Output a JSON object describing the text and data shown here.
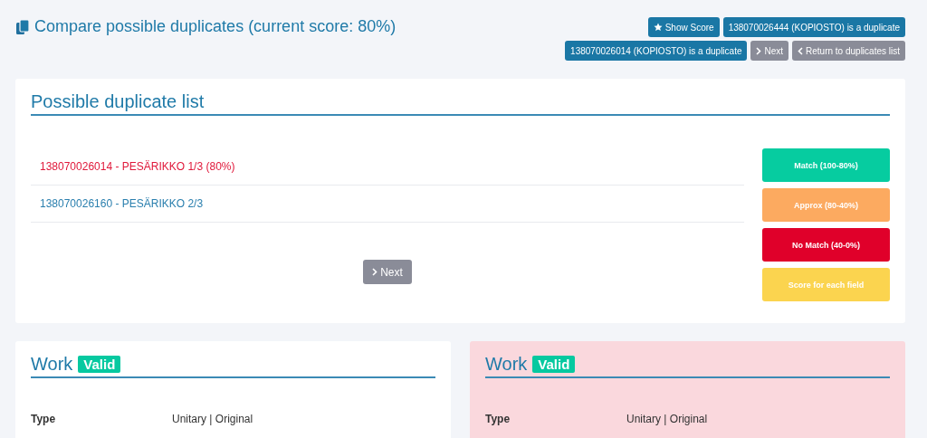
{
  "header": {
    "title": "Compare possible duplicates (current score: 80%)"
  },
  "actions": [
    {
      "label": "Show Score",
      "kind": "score"
    },
    {
      "label": "138070026444 (KOPIOSTO) is a duplicate",
      "kind": "duplicate"
    },
    {
      "label": "138070026014 (KOPIOSTO) is a duplicate",
      "kind": "duplicate"
    },
    {
      "label": "Next",
      "kind": "next"
    },
    {
      "label": "Return to duplicates list",
      "kind": "back"
    }
  ],
  "duplicate_list": {
    "title": "Possible duplicate list",
    "items": [
      {
        "label": "138070026014 - PESÄRIKKO 1/3 (80%)",
        "selected": true
      },
      {
        "label": "138070026160 - PESÄRIKKO 2/3",
        "selected": false
      }
    ],
    "next_button": "Next",
    "legend": [
      {
        "label": "Match (100-80%)",
        "color": "#06cca0"
      },
      {
        "label": "Approx (80-40%)",
        "color": "#fcaa60"
      },
      {
        "label": "No Match (40-0%)",
        "color": "#e0002a"
      },
      {
        "label": "Score for each field",
        "color": "#fbd44f"
      }
    ]
  },
  "works": [
    {
      "title": "Work",
      "status": "Valid",
      "highlighted": false,
      "fields": [
        {
          "label": "Type",
          "value": "Unitary | Original"
        }
      ]
    },
    {
      "title": "Work",
      "status": "Valid",
      "highlighted": true,
      "fields": [
        {
          "label": "Type",
          "value": "Unitary | Original"
        }
      ]
    }
  ]
}
